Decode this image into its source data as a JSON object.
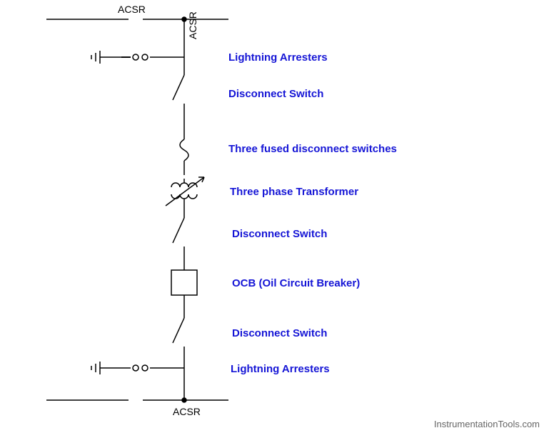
{
  "diagram": {
    "top_label": "ACSR",
    "top_vert": "ACSR",
    "bottom_label": "ACSR",
    "components": [
      {
        "name": "Lightning Arresters"
      },
      {
        "name": "Disconnect Switch"
      },
      {
        "name": "Three fused disconnect switches"
      },
      {
        "name": "Three phase Transformer"
      },
      {
        "name": "Disconnect Switch"
      },
      {
        "name": "OCB (Oil Circuit Breaker)"
      },
      {
        "name": "Disconnect Switch"
      },
      {
        "name": "Lightning Arresters"
      }
    ]
  },
  "watermark": "InstrumentationTools.com"
}
